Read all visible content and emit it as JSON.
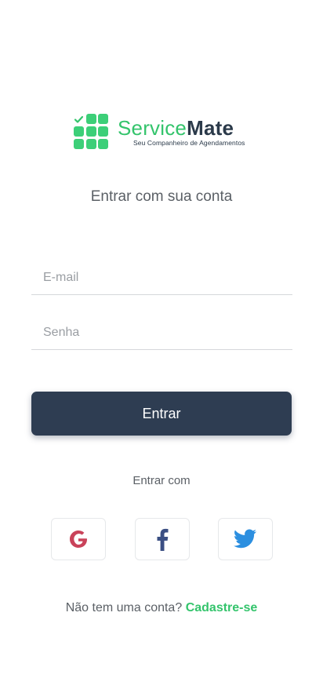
{
  "brand": {
    "name_part1": "Service",
    "name_part2": "Mate",
    "tagline": "Seu Companheiro de Agendamentos",
    "colors": {
      "green": "#34c46c",
      "navy": "#2b3a4a"
    }
  },
  "login": {
    "heading": "Entrar com sua conta",
    "email_placeholder": "E-mail",
    "email_value": "",
    "password_placeholder": "Senha",
    "password_value": "",
    "submit_label": "Entrar"
  },
  "social": {
    "label": "Entrar com",
    "providers": [
      {
        "name": "Google",
        "icon": "google-icon",
        "color": "#c9435a"
      },
      {
        "name": "Facebook",
        "icon": "facebook-icon",
        "color": "#3b4f83"
      },
      {
        "name": "Twitter",
        "icon": "twitter-icon",
        "color": "#2c8fe0"
      }
    ]
  },
  "signup": {
    "prompt": "Não tem uma conta?",
    "link_label": "Cadastre-se"
  }
}
